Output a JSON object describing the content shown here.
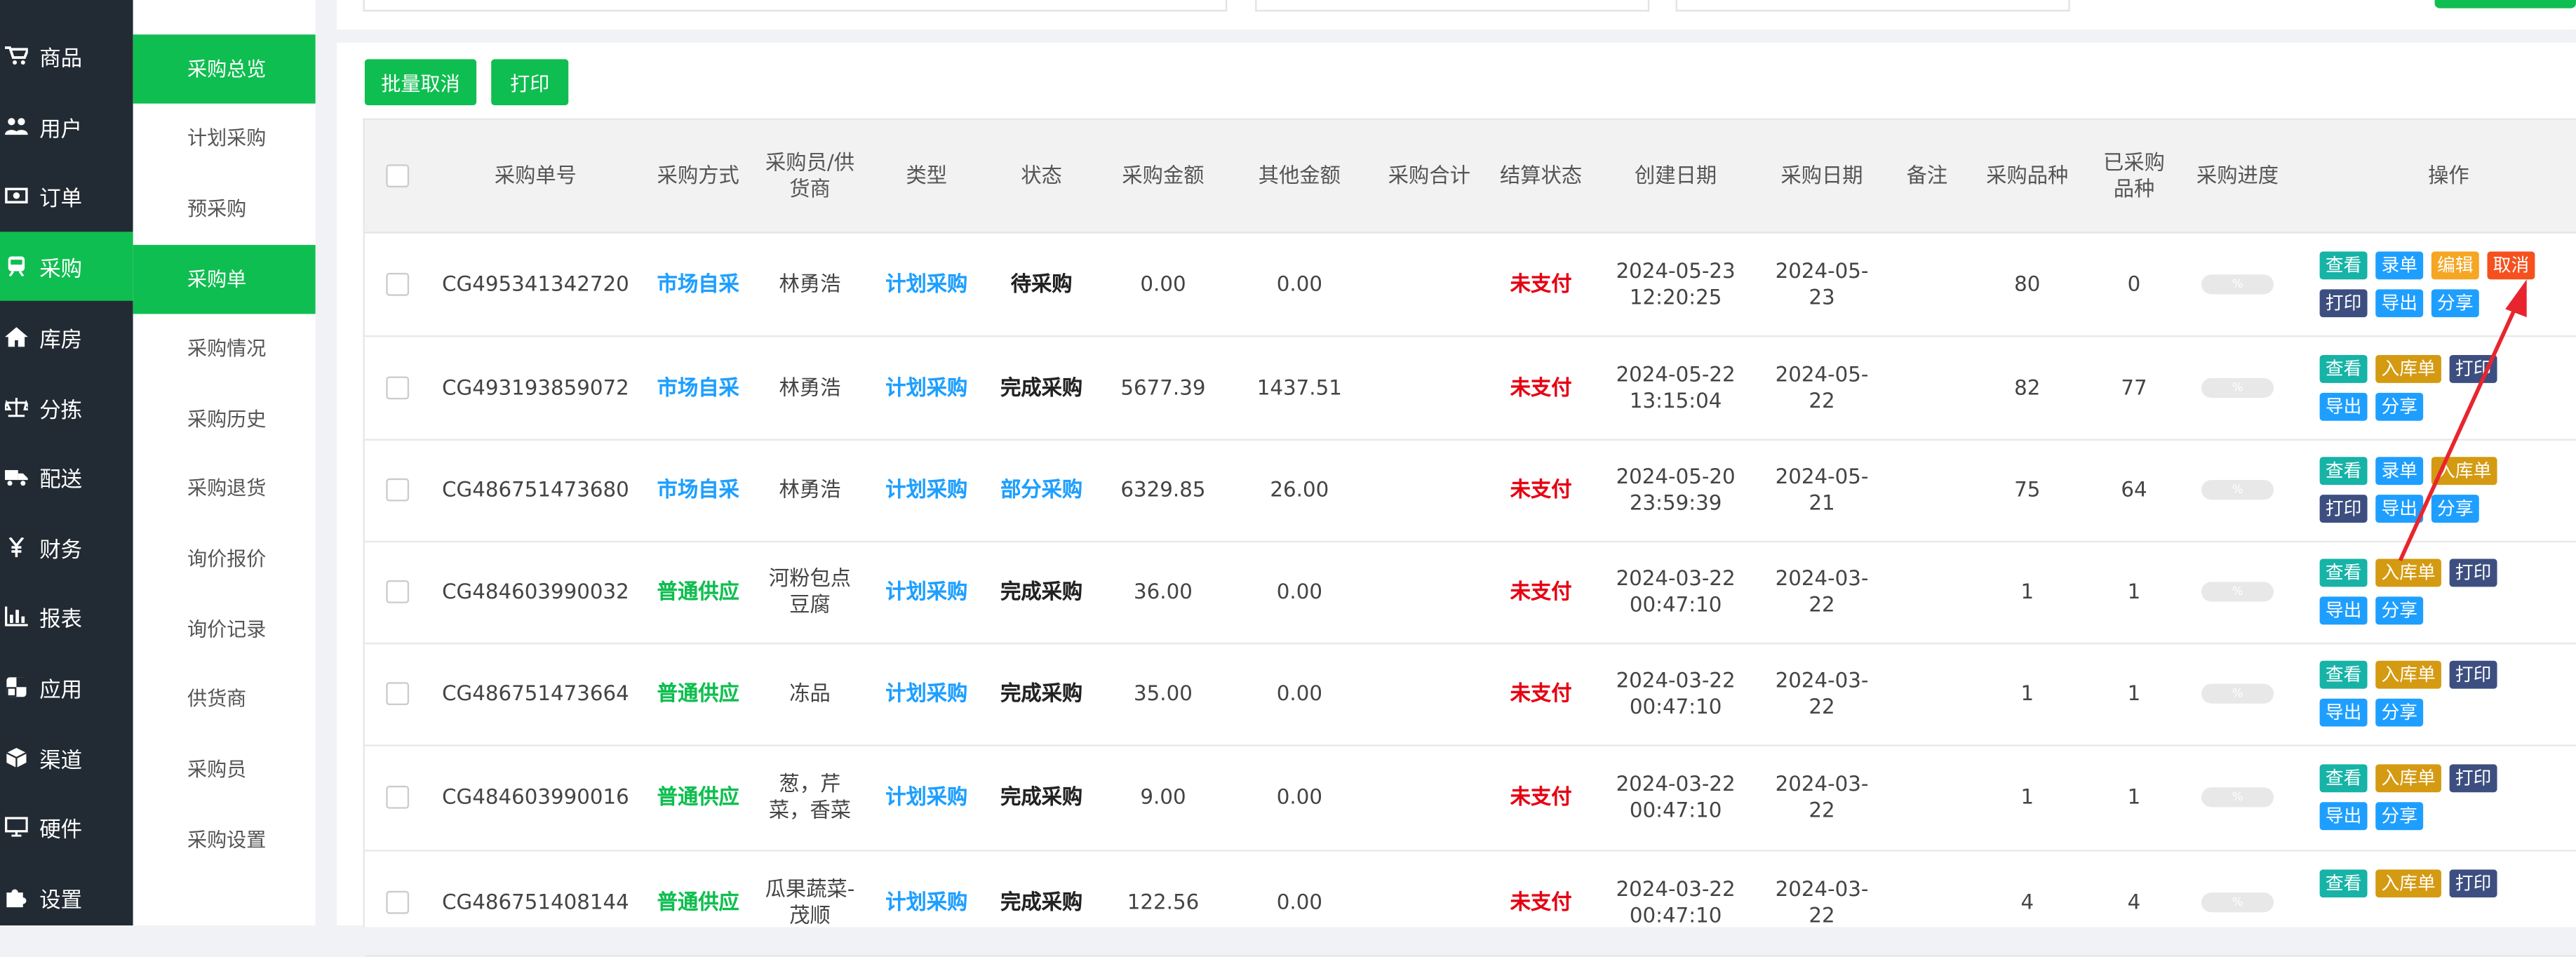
{
  "nav": [
    {
      "label": "商品",
      "icon": "cart-icon"
    },
    {
      "label": "用户",
      "icon": "users-icon"
    },
    {
      "label": "订单",
      "icon": "money-icon"
    },
    {
      "label": "采购",
      "icon": "train-icon"
    },
    {
      "label": "库房",
      "icon": "home-icon"
    },
    {
      "label": "分拣",
      "icon": "scale-icon"
    },
    {
      "label": "配送",
      "icon": "truck-icon"
    },
    {
      "label": "财务",
      "icon": "yen-icon"
    },
    {
      "label": "报表",
      "icon": "chart-icon"
    },
    {
      "label": "应用",
      "icon": "apps-icon"
    },
    {
      "label": "渠道",
      "icon": "cube-icon"
    },
    {
      "label": "硬件",
      "icon": "monitor-icon"
    },
    {
      "label": "设置",
      "icon": "puzzle-icon"
    }
  ],
  "submenu": [
    "采购总览",
    "计划采购",
    "预采购",
    "采购单",
    "采购情况",
    "采购历史",
    "采购退货",
    "询价报价",
    "询价记录",
    "供货商",
    "采购员",
    "采购设置"
  ],
  "toolbar": {
    "batch_cancel": "批量取消",
    "print": "打印"
  },
  "headers": [
    "采购单号",
    "采购方式",
    "采购员/供货商",
    "类型",
    "状态",
    "采购金额",
    "其他金额",
    "采购合计",
    "结算状态",
    "创建日期",
    "采购日期",
    "备注",
    "采购品种",
    "已采购品种",
    "采购进度",
    "操作"
  ],
  "progress_text": "%",
  "rows": [
    {
      "no": "CG495341342720",
      "method": "市场自采",
      "supplier": "林勇浩",
      "type": "计划采购",
      "status": "待采购",
      "amount": "0.00",
      "other": "0.00",
      "total": "",
      "settle": "未支付",
      "created": "2024-05-23 12:20:25",
      "date": "2024-05-23",
      "note": "",
      "kinds": "80",
      "done": "0",
      "ops": [
        "查看",
        "录单",
        "编辑",
        "取消",
        "打印",
        "导出",
        "分享"
      ]
    },
    {
      "no": "CG493193859072",
      "method": "市场自采",
      "supplier": "林勇浩",
      "type": "计划采购",
      "status": "完成采购",
      "amount": "5677.39",
      "other": "1437.51",
      "total": "",
      "settle": "未支付",
      "created": "2024-05-22 13:15:04",
      "date": "2024-05-22",
      "note": "",
      "kinds": "82",
      "done": "77",
      "ops": [
        "查看",
        "入库单",
        "打印",
        "导出",
        "分享"
      ]
    },
    {
      "no": "CG486751473680",
      "method": "市场自采",
      "supplier": "林勇浩",
      "type": "计划采购",
      "status": "部分采购",
      "amount": "6329.85",
      "other": "26.00",
      "total": "",
      "settle": "未支付",
      "created": "2024-05-20 23:59:39",
      "date": "2024-05-21",
      "note": "",
      "kinds": "75",
      "done": "64",
      "ops": [
        "查看",
        "录单",
        "入库单",
        "打印",
        "导出",
        "分享"
      ]
    },
    {
      "no": "CG484603990032",
      "method": "普通供应",
      "supplier": "河粉包点豆腐",
      "type": "计划采购",
      "status": "完成采购",
      "amount": "36.00",
      "other": "0.00",
      "total": "",
      "settle": "未支付",
      "created": "2024-03-22 00:47:10",
      "date": "2024-03-22",
      "note": "",
      "kinds": "1",
      "done": "1",
      "ops": [
        "查看",
        "入库单",
        "打印",
        "导出",
        "分享"
      ]
    },
    {
      "no": "CG486751473664",
      "method": "普通供应",
      "supplier": "冻品",
      "type": "计划采购",
      "status": "完成采购",
      "amount": "35.00",
      "other": "0.00",
      "total": "",
      "settle": "未支付",
      "created": "2024-03-22 00:47:10",
      "date": "2024-03-22",
      "note": "",
      "kinds": "1",
      "done": "1",
      "ops": [
        "查看",
        "入库单",
        "打印",
        "导出",
        "分享"
      ]
    },
    {
      "no": "CG484603990016",
      "method": "普通供应",
      "supplier": "葱，芹菜，香菜",
      "type": "计划采购",
      "status": "完成采购",
      "amount": "9.00",
      "other": "0.00",
      "total": "",
      "settle": "未支付",
      "created": "2024-03-22 00:47:10",
      "date": "2024-03-22",
      "note": "",
      "kinds": "1",
      "done": "1",
      "ops": [
        "查看",
        "入库单",
        "打印",
        "导出",
        "分享"
      ]
    },
    {
      "no": "CG486751408144",
      "method": "普通供应",
      "supplier": "瓜果蔬菜-茂顺",
      "type": "计划采购",
      "status": "完成采购",
      "amount": "122.56",
      "other": "0.00",
      "total": "",
      "settle": "未支付",
      "created": "2024-03-22 00:47:10",
      "date": "2024-03-22",
      "note": "",
      "kinds": "4",
      "done": "4",
      "ops": [
        "查看",
        "入库单",
        "打印"
      ]
    }
  ],
  "colors": {
    "accent": "#0fbe50",
    "nav_bg": "#222b33",
    "link_blue": "#1e9fff",
    "unpaid_red": "#e60012",
    "annotation_arrow": "#e8252e"
  }
}
